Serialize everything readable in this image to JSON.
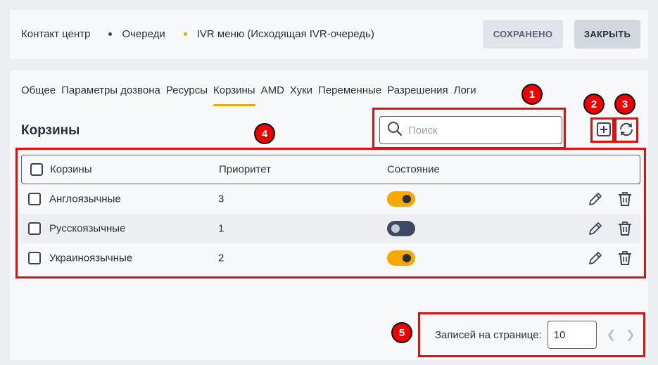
{
  "breadcrumb": [
    "Контакт центр",
    "Очереди",
    "IVR меню (Исходящая IVR-очередь)"
  ],
  "header": {
    "saved_label": "СОХРАНЕНО",
    "close_label": "ЗАКРЫТЬ"
  },
  "tabs": [
    {
      "label": "Общее"
    },
    {
      "label": "Параметры дозвона"
    },
    {
      "label": "Ресурсы"
    },
    {
      "label": "Корзины",
      "active": true
    },
    {
      "label": "AMD"
    },
    {
      "label": "Хуки"
    },
    {
      "label": "Переменные"
    },
    {
      "label": "Разрешения"
    },
    {
      "label": "Логи"
    }
  ],
  "section": {
    "title": "Корзины"
  },
  "search": {
    "placeholder": "Поиск"
  },
  "table": {
    "columns": [
      "Корзины",
      "Приоритет",
      "Состояние"
    ],
    "rows": [
      {
        "name": "Англоязычные",
        "priority": "3",
        "enabled": true
      },
      {
        "name": "Русскоязычные",
        "priority": "1",
        "enabled": false
      },
      {
        "name": "Украиноязычные",
        "priority": "2",
        "enabled": true
      }
    ]
  },
  "pagination": {
    "label": "Записей на странице:",
    "page_size": "10"
  },
  "badges": [
    "1",
    "2",
    "3",
    "4",
    "5"
  ],
  "colors": {
    "accent": "#f0a30a",
    "annotation": "#e01010",
    "toggle_on": "#f5a800",
    "toggle_off": "#3d4a63"
  },
  "icons": [
    "search-icon",
    "add-square-icon",
    "refresh-icon",
    "edit-pencil-icon",
    "trash-icon",
    "chevron-left-icon",
    "chevron-right-icon"
  ]
}
